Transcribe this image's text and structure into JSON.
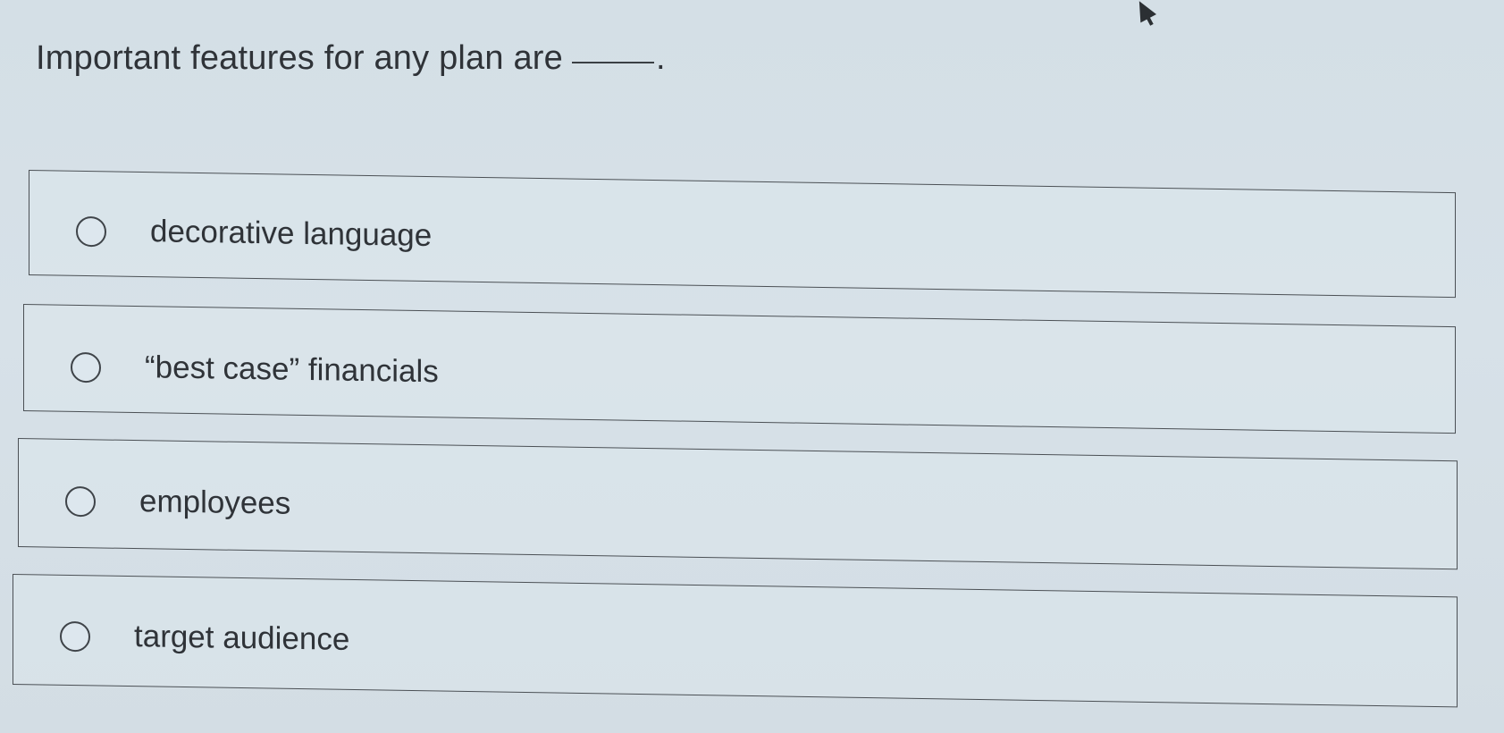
{
  "question": {
    "text": "Important features for any plan are",
    "blank_suffix": "."
  },
  "options": [
    {
      "label": "decorative language",
      "selected": false
    },
    {
      "label": "“best case” financials",
      "selected": false
    },
    {
      "label": "employees",
      "selected": false
    },
    {
      "label": "target audience",
      "selected": false
    }
  ],
  "icons": {
    "radio": "radio-empty-icon",
    "cursor": "mouse-pointer-icon"
  },
  "colors": {
    "background": "#d4dfe6",
    "text": "#2f3338",
    "border": "#4b5055"
  }
}
